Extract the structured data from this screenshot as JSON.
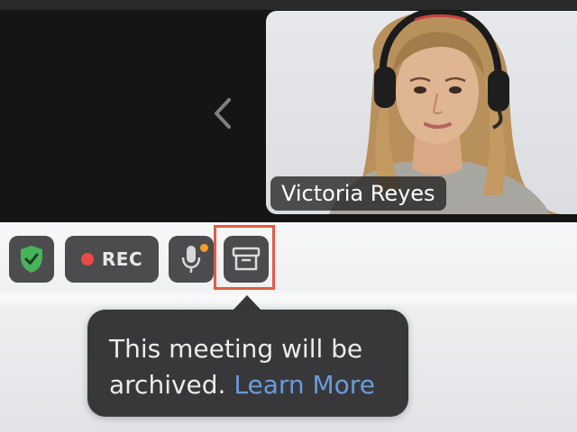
{
  "participant": {
    "name": "Victoria Reyes"
  },
  "toolbar": {
    "rec_label": "REC"
  },
  "tooltip": {
    "line1": "This meeting will be",
    "line2_prefix": "archived.",
    "link_label": "Learn More"
  },
  "icons": {
    "prev": "chevron-left-icon",
    "security": "shield-check-icon",
    "record": "record-dot-icon",
    "mic": "microphone-icon",
    "archive": "archive-box-icon"
  },
  "colors": {
    "shield_green": "#46b35a",
    "rec_red": "#ea4a43",
    "mic_badge": "#f29d2c",
    "highlight": "#e35a48",
    "link": "#6a9bde",
    "tooltip_bg": "#38383a",
    "button_bg": "#4c4c4e"
  }
}
